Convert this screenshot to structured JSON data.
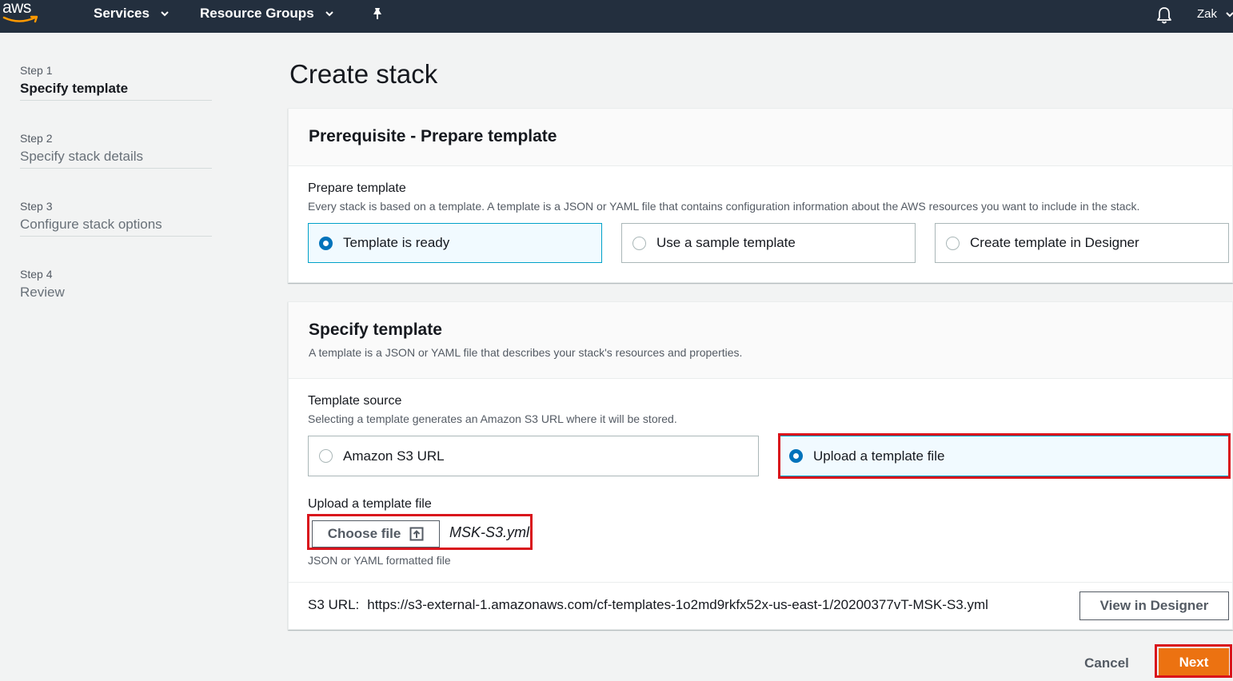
{
  "nav": {
    "logo_text": "aws",
    "services_label": "Services",
    "resource_groups_label": "Resource Groups",
    "user_label": "Zak",
    "icons": [
      "aws-logo",
      "chevron-down-icon",
      "pin-icon",
      "bell-icon"
    ]
  },
  "steps": [
    {
      "num": "Step 1",
      "title": "Specify template",
      "active": true
    },
    {
      "num": "Step 2",
      "title": "Specify stack details",
      "active": false
    },
    {
      "num": "Step 3",
      "title": "Configure stack options",
      "active": false
    },
    {
      "num": "Step 4",
      "title": "Review",
      "active": false
    }
  ],
  "page_title": "Create stack",
  "prerequisite": {
    "heading": "Prerequisite - Prepare template",
    "field_label": "Prepare template",
    "field_desc": "Every stack is based on a template. A template is a JSON or YAML file that contains configuration information about the AWS resources you want to include in the stack.",
    "options": [
      {
        "label": "Template is ready",
        "selected": true
      },
      {
        "label": "Use a sample template",
        "selected": false
      },
      {
        "label": "Create template in Designer",
        "selected": false
      }
    ]
  },
  "specify": {
    "heading": "Specify template",
    "desc": "A template is a JSON or YAML file that describes your stack's resources and properties.",
    "source_label": "Template source",
    "source_desc": "Selecting a template generates an Amazon S3 URL where it will be stored.",
    "source_options": [
      {
        "label": "Amazon S3 URL",
        "selected": false
      },
      {
        "label": "Upload a template file",
        "selected": true
      }
    ],
    "upload_label": "Upload a template file",
    "choose_file_label": "Choose file",
    "file_name": "MSK-S3.yml",
    "file_hint": "JSON or YAML formatted file",
    "s3_url_label": "S3 URL:",
    "s3_url_value": "https://s3-external-1.amazonaws.com/cf-templates-1o2md9rkfx52x-us-east-1/20200377vT-MSK-S3.yml",
    "view_designer_label": "View in Designer"
  },
  "footer": {
    "cancel_label": "Cancel",
    "next_label": "Next"
  },
  "colors": {
    "nav_bg": "#232f3e",
    "primary_button": "#ec7211",
    "selected_tile_bg": "#f1faff",
    "selected_tile_border": "#00a1c9",
    "radio_selected": "#0073bb",
    "annotation_highlight": "#d9141c"
  }
}
